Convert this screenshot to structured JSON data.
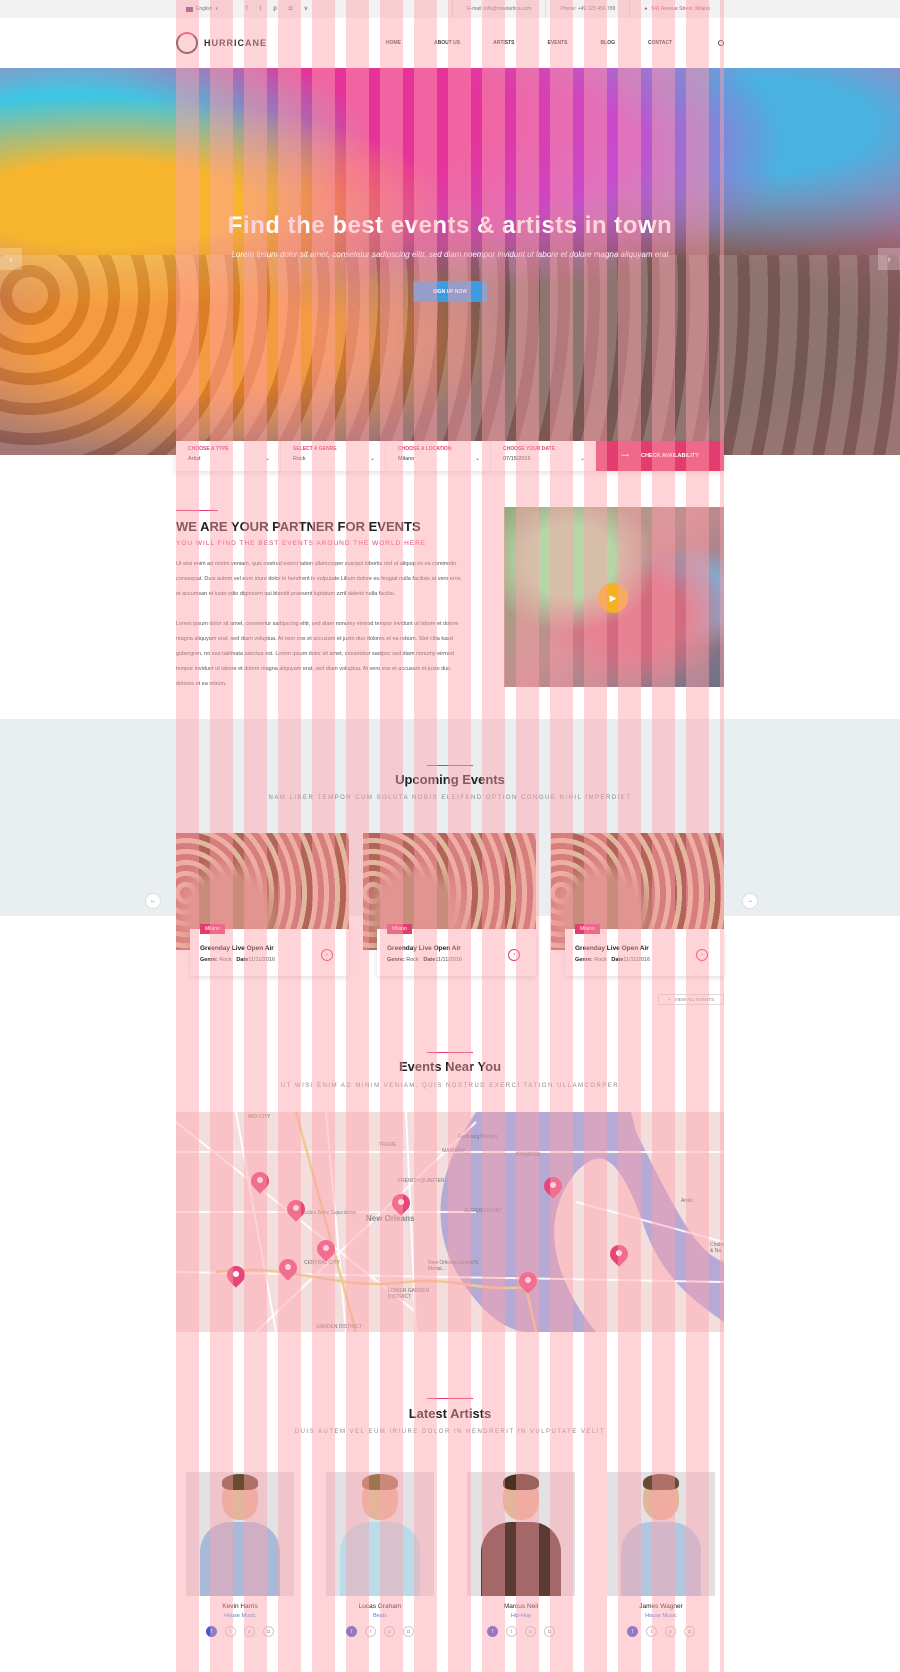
{
  "topbar": {
    "language": "English",
    "social": [
      "f",
      "t",
      "p",
      "◘",
      "v"
    ],
    "email": "E-mail: info@meetartica.com",
    "phone": "Phone: +49 123 456 789",
    "address": "541 Avenue Street, Milano"
  },
  "header": {
    "logo": "HURRICANE",
    "nav": [
      "HOME",
      "ABOUT US",
      "ARTISTS",
      "EVENTS",
      "BLOG",
      "CONTACT"
    ]
  },
  "hero": {
    "title": "Find the best events & artists in town",
    "subtitle": "Lorem ipsum dolor sit amet, consetetur sadipscing elitr, sed diam noempor invidunt ut labore et dolore magna aliquyam erat",
    "button": "SIGN UP NOW"
  },
  "search": {
    "fields": [
      {
        "label": "CHOOSE A TYPE",
        "value": "Artist"
      },
      {
        "label": "SELECT A GENRE",
        "value": "Rock"
      },
      {
        "label": "CHOOSE A LOCATION",
        "value": "Milano"
      },
      {
        "label": "CHOOSE YOUR DATE",
        "value": "07/15/2016"
      }
    ],
    "button": "CHECK AVAILABILITY"
  },
  "partner": {
    "title": "WE ARE YOUR PARTNER FOR EVENTS",
    "subtitle": "YOU WILL FIND THE BEST EVENTS AROUND THE WORLD HERE",
    "p1_lines": [
      "Ut wisi enim ad minim veniam, quis nostrud exerci tation ullamcorper suscipit lobortis nisl ut aliquip ex ea commodo",
      "consequat. Duis autem vel eum iriure dolor in hendrerit in vulputate Lillum dolore eu feugiat nulla facilisis at vero eros",
      "et accumsan et iusto odio dignissim qui blandit praesent luptatum zzril delenit nulla facilisi."
    ],
    "p2_lines": [
      "Lorem ipsum dolor sit amet, consetetur sadipscing elitr, sed diam nonumy eirmod tempor invidunt ut labore et dolore",
      "magna aliquyam erat, sed diam voluptua. At vero eos et accusam et justo duo dolores et ea rebum. Stet clita kasd",
      "gubergren, no sea takimata sanctus est. Lorem ipsum dolor sit amet, consetetur sadipsc sed diam nonumy eirmod",
      "tempor invidunt ut labore et dolore magna aliquyam erat, sed diam voluptua. At vero eos et accusam et justo duo",
      "dolores et ea rebum."
    ]
  },
  "upcoming": {
    "title": "Upcoming Events",
    "subtitle": "NAM LIBER TEMPOR CUM SOLUTA NOBIS ELEIFEND OPTION CONGUE NIHIL IMPERDIET",
    "events": [
      {
        "tag": "Milano",
        "name": "Greenday Live Open Air",
        "genre_label": "Genre:",
        "genre": "Rock",
        "date_label": "Date",
        "date": "11/11/2016"
      },
      {
        "tag": "Milano",
        "name": "Greenday Live Open Air",
        "genre_label": "Genre:",
        "genre": "Rock",
        "date_label": "Date",
        "date": "11/11/2016"
      },
      {
        "tag": "Milano",
        "name": "Greenday Live Open Air",
        "genre_label": "Genre:",
        "genre": "Rock",
        "date_label": "Date",
        "date": "11/11/2016"
      }
    ],
    "view_all": "VIEW ALL EVENTS"
  },
  "near": {
    "title": "Events Near You",
    "subtitle": "UT WISI ENIM AD MINIM VENIAM, QUIS NOSTRUD EXERCI TATION ULLAMCORPER",
    "map_labels": [
      "MID-CITY",
      "TREME",
      "Faubourg Marigny",
      "MARIGNY",
      "BYWATER",
      "FRENCH QUARTER",
      "Mercedes-Benz Superdome",
      "New Orleans",
      "ALGIERS POINT",
      "CENTRAL CITY",
      "New Orleans Ernest N. Morial...",
      "LOWER GARDEN DISTRICT",
      "GARDEN DISTRICT",
      "Arabi",
      "Chalm & Na"
    ]
  },
  "artists": {
    "title": "Latest Artists",
    "subtitle": "DUIS AUTEM VEL EUM IRIURE DOLOR IN HENDRERIT IN VULPUTATE VELIT",
    "list": [
      {
        "name": "Kevin Harris",
        "genre": "House Music"
      },
      {
        "name": "Lucas Graham",
        "genre": "Beats"
      },
      {
        "name": "Marcus Neil",
        "genre": "Hip-Hop"
      },
      {
        "name": "James Wagner",
        "genre": "House Music"
      }
    ]
  },
  "colors": {
    "accent": "#e23d6f",
    "button_blue": "#3f9be0",
    "genre_blue": "#3f7fe0"
  }
}
